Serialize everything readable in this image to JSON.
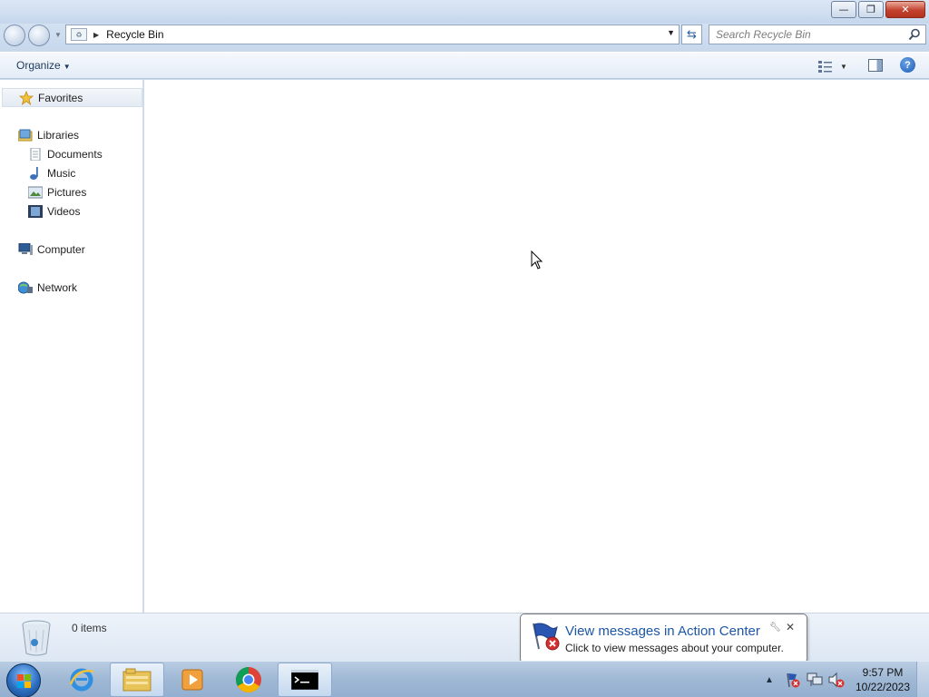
{
  "window": {
    "minimize_label": "—",
    "restore_label": "❐",
    "close_label": "✕"
  },
  "address": {
    "location": "Recycle Bin",
    "search_placeholder": "Search Recycle Bin"
  },
  "toolbar": {
    "organize_label": "Organize",
    "help_label": "?"
  },
  "navigation": {
    "favorites": "Favorites",
    "libraries": "Libraries",
    "library_items": [
      "Documents",
      "Music",
      "Pictures",
      "Videos"
    ],
    "computer": "Computer",
    "network": "Network"
  },
  "details": {
    "item_count": "0 items"
  },
  "notification": {
    "title": "View messages in Action Center",
    "message": "Click to view messages about your computer."
  },
  "taskbar": {
    "time": "9:57 PM",
    "date": "10/22/2023"
  },
  "colors": {
    "accent": "#1d56a8",
    "frame": "#c9d8ea"
  }
}
